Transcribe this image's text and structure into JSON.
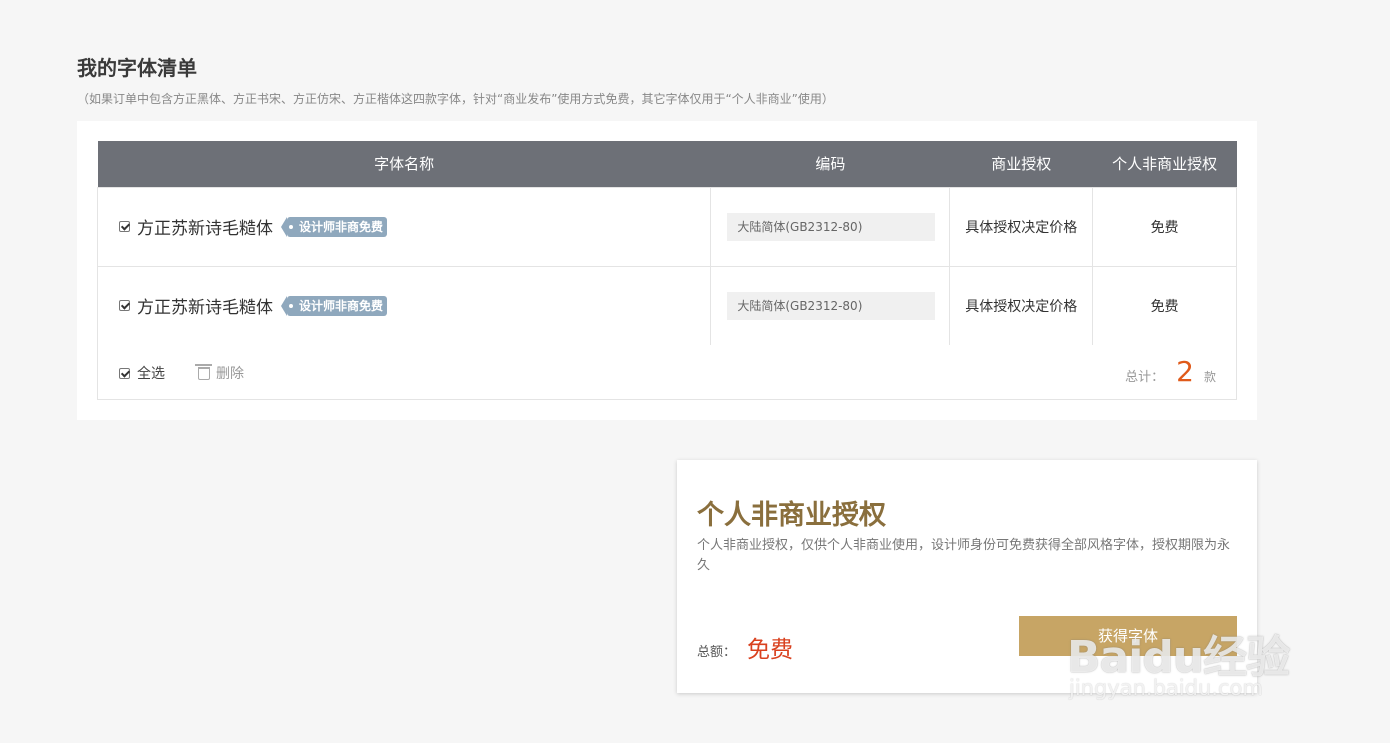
{
  "header": {
    "title": "我的字体清单",
    "subtitle": "（如果订单中包含方正黑体、方正书宋、方正仿宋、方正楷体这四款字体，针对“商业发布”使用方式免费，其它字体仅用于“个人非商业”使用）"
  },
  "table": {
    "columns": [
      "字体名称",
      "编码",
      "商业授权",
      "个人非商业授权"
    ],
    "rows": [
      {
        "name": "方正苏新诗毛糙体",
        "tag": "设计师非商免费",
        "encoding": "大陆简体(GB2312-80)",
        "commercial": "具体授权决定价格",
        "personal": "免费",
        "checked": true
      },
      {
        "name": "方正苏新诗毛糙体",
        "tag": "设计师非商免费",
        "encoding": "大陆简体(GB2312-80)",
        "commercial": "具体授权决定价格",
        "personal": "免费",
        "checked": true
      }
    ]
  },
  "footer": {
    "select_all": "全选",
    "delete": "删除",
    "total_label": "总计：",
    "total_count": "2",
    "total_unit": "款"
  },
  "license": {
    "title": "个人非商业授权",
    "description": "个人非商业授权，仅供个人非商业使用，设计师身份可免费获得全部风格字体，授权期限为永久",
    "amount_label": "总额：",
    "amount_value": "免费",
    "button_label": "获得字体"
  },
  "watermark": {
    "logo_text": "Baidu经验",
    "url": "jingyan.baidu.com"
  },
  "colors": {
    "table_header": "#6d7077",
    "tag": "#8fa8bd",
    "accent_orange": "#e05a1a",
    "license_title": "#8a6f3d",
    "button": "#c7a565",
    "free_red": "#d9411f"
  }
}
